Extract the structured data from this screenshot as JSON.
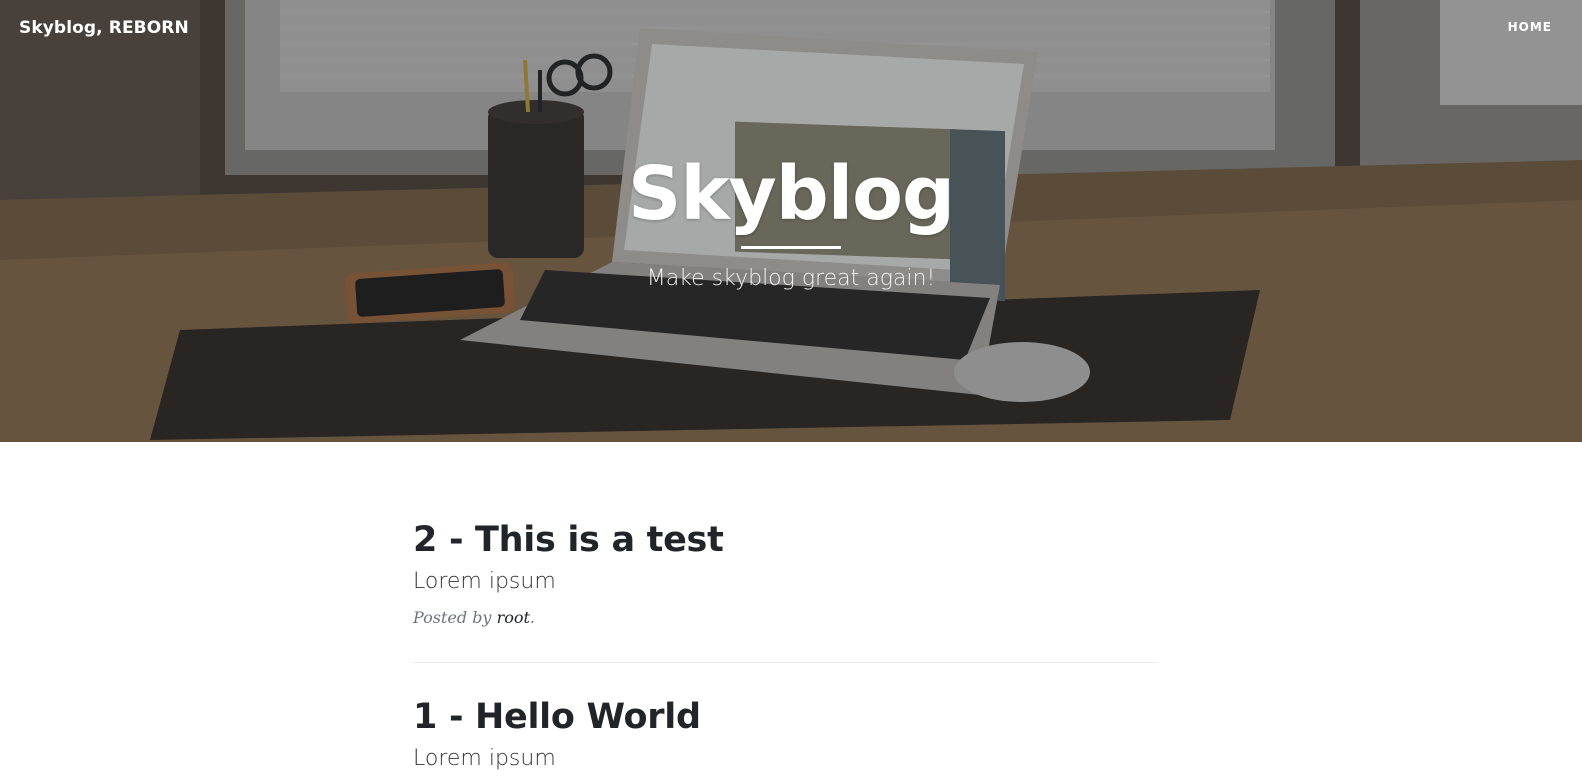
{
  "nav": {
    "brand": "Skyblog, REBORN",
    "home": "HOME"
  },
  "header": {
    "title": "Skyblog",
    "subtitle": "Make skyblog great again!"
  },
  "posts": [
    {
      "title": "2 - This is a test",
      "subtitle": "Lorem ipsum",
      "meta_prefix": "Posted by",
      "author": "root",
      "meta_suffix": "."
    },
    {
      "title": "1 - Hello World",
      "subtitle": "Lorem ipsum"
    }
  ],
  "colors": {
    "hero_overlay": "#212529",
    "text_dark": "#212529",
    "meta_gray": "#6c757d",
    "divider": "#e9ecef"
  }
}
